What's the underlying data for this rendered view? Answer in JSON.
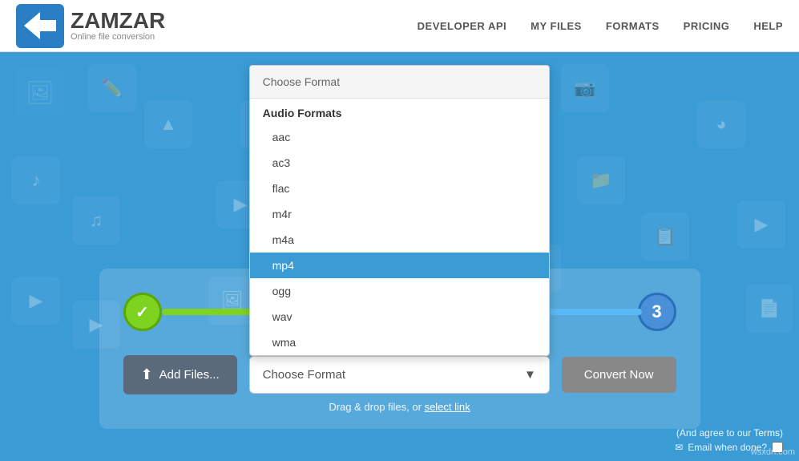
{
  "header": {
    "logo_main": "ZAMZAR",
    "logo_sub": "Online file conversion",
    "nav": [
      {
        "label": "DEVELOPER API",
        "key": "developer-api"
      },
      {
        "label": "MY FILES",
        "key": "my-files"
      },
      {
        "label": "FORMATS",
        "key": "formats"
      },
      {
        "label": "PRICING",
        "key": "pricing"
      },
      {
        "label": "HELP",
        "key": "help"
      }
    ]
  },
  "converter": {
    "add_files_label": "Add Files...",
    "format_label": "Choose Format",
    "convert_label": "Convert Now",
    "drag_drop_text": "Drag & drop files, or ",
    "select_link": "select link",
    "agree_text": "(And agree to our ",
    "terms_text": "Terms",
    "agree_end": ")",
    "email_label": "Email when done?"
  },
  "dropdown": {
    "header": "Choose Format",
    "section_audio": "Audio Formats",
    "items": [
      {
        "label": "aac",
        "selected": false
      },
      {
        "label": "ac3",
        "selected": false
      },
      {
        "label": "flac",
        "selected": false
      },
      {
        "label": "m4r",
        "selected": false
      },
      {
        "label": "m4a",
        "selected": false
      },
      {
        "label": "mp4",
        "selected": true
      },
      {
        "label": "ogg",
        "selected": false
      },
      {
        "label": "wav",
        "selected": false
      },
      {
        "label": "wma",
        "selected": false
      }
    ]
  },
  "steps": {
    "step1_check": "✓",
    "step3_num": "3"
  },
  "watermark": "wsxdn.com"
}
